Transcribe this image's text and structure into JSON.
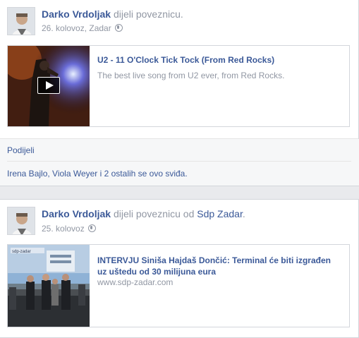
{
  "posts": [
    {
      "author": "Darko Vrdoljak",
      "verb": "dijeli poveznicu.",
      "meta": "26. kolovoz, Zadar",
      "link": {
        "title": "U2 - 11 O'Clock Tick Tock (From Red Rocks)",
        "desc": "The best live song from U2 ever, from Red Rocks."
      },
      "share_label": "Podijeli",
      "likes_text": "Irena Bajlo, Viola Weyer i 2 ostalih se ovo sviđa."
    },
    {
      "author": "Darko Vrdoljak",
      "verb": "dijeli poveznicu",
      "verb_od": "od",
      "page": "Sdp Zadar",
      "period": ".",
      "meta": "25. kolovoz",
      "link": {
        "title": "INTERVJU Siniša Hajdaš Dončić: Terminal će biti izgrađen uz uštedu od 30 milijuna eura",
        "desc": "www.sdp-zadar.com",
        "image_text": "sdp-zadar"
      }
    }
  ],
  "colors": {
    "link": "#3b5998",
    "muted": "#9197a3",
    "bg": "#e9eaed"
  },
  "icons": {
    "privacy": "globe-icon",
    "play": "play-icon"
  }
}
